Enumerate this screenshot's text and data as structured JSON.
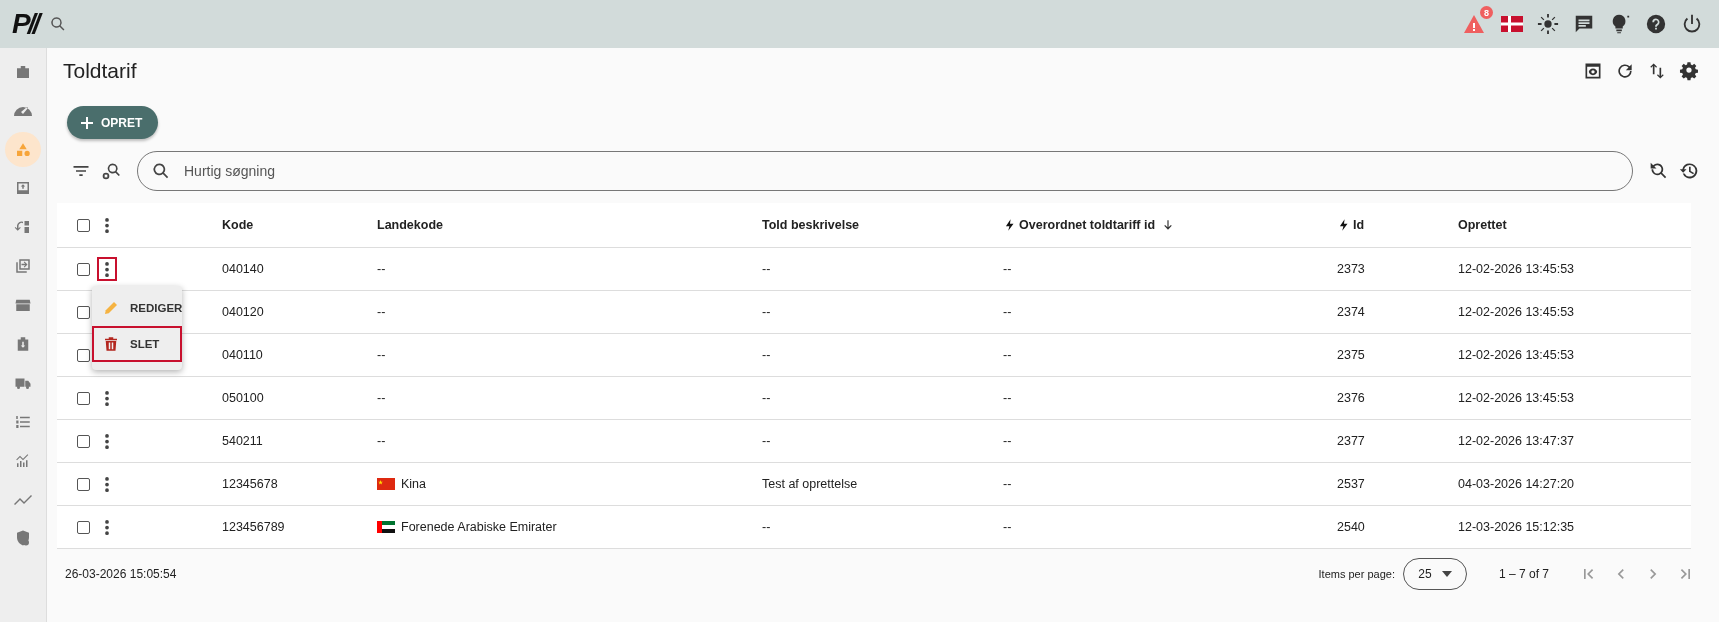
{
  "topbar": {
    "logo": "P//",
    "alert_count": "8"
  },
  "sidebar": {
    "items": [
      {
        "selected": false
      },
      {
        "selected": false
      },
      {
        "selected": true
      },
      {
        "selected": false
      },
      {
        "selected": false
      },
      {
        "selected": false
      },
      {
        "selected": false
      },
      {
        "selected": false
      },
      {
        "selected": false
      },
      {
        "selected": false
      },
      {
        "selected": false
      },
      {
        "selected": false
      },
      {
        "selected": false
      }
    ]
  },
  "page": {
    "title": "Toldtarif",
    "create_button": "OPRET",
    "search": {
      "placeholder": "Hurtig søgning"
    }
  },
  "table": {
    "header_checked": false,
    "columns": [
      {
        "label": "Kode",
        "lightning": false,
        "sorted": false
      },
      {
        "label": "Landekode",
        "lightning": false,
        "sorted": false
      },
      {
        "label": "Told beskrivelse",
        "lightning": false,
        "sorted": false
      },
      {
        "label": "Overordnet toldtariff id",
        "lightning": true,
        "sorted": true
      },
      {
        "label": "Id",
        "lightning": true,
        "sorted": false
      },
      {
        "label": "Oprettet",
        "lightning": false,
        "sorted": false
      }
    ],
    "rows": [
      {
        "checked": false,
        "menu_open": true,
        "kind": "plain",
        "cells": [
          "040140",
          "--",
          "--",
          "--",
          "2373",
          "12-02-2026 13:45:53"
        ]
      },
      {
        "checked": false,
        "menu_open": false,
        "kind": "plain",
        "cells": [
          "040120",
          "--",
          "--",
          "--",
          "2374",
          "12-02-2026 13:45:53"
        ]
      },
      {
        "checked": false,
        "menu_open": false,
        "kind": "plain",
        "cells": [
          "040110",
          "--",
          "--",
          "--",
          "2375",
          "12-02-2026 13:45:53"
        ]
      },
      {
        "checked": false,
        "menu_open": false,
        "kind": "plain",
        "cells": [
          "050100",
          "--",
          "--",
          "--",
          "2376",
          "12-02-2026 13:45:53"
        ]
      },
      {
        "checked": false,
        "menu_open": false,
        "kind": "plain",
        "cells": [
          "540211",
          "--",
          "--",
          "--",
          "2377",
          "12-02-2026 13:47:37"
        ]
      },
      {
        "checked": false,
        "menu_open": false,
        "kind": "china_flag",
        "cells": [
          "12345678",
          "Kina",
          "Test af oprettelse",
          "--",
          "2537",
          "04-03-2026 14:27:20"
        ]
      },
      {
        "checked": false,
        "menu_open": false,
        "kind": "uae_flag",
        "cells": [
          "123456789",
          "Forenede Arabiske Emirater",
          "--",
          "--",
          "2540",
          "12-03-2026 15:12:35"
        ]
      }
    ],
    "row_menu": [
      {
        "kind": "edit",
        "label": "REDIGER",
        "highlighted": false
      },
      {
        "kind": "delete",
        "label": "SLET",
        "highlighted": true
      }
    ]
  },
  "footer": {
    "timestamp": "26-03-2026 15:05:54",
    "items_per_page_label": "Items per page:",
    "items_per_page": "25",
    "range": "1 – 7 of 7"
  }
}
